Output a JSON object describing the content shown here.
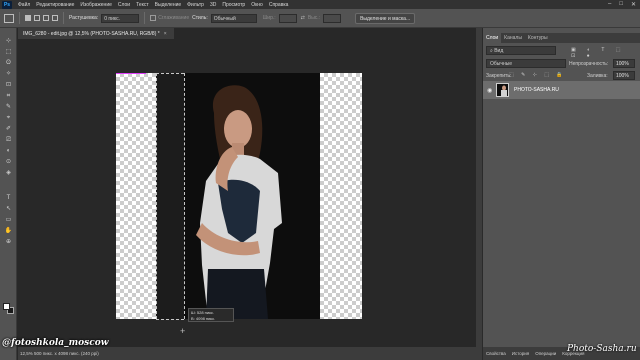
{
  "app": {
    "logo": "Ps",
    "menu": [
      "Файл",
      "Редактирование",
      "Изображение",
      "Слои",
      "Текст",
      "Выделение",
      "Фильтр",
      "3D",
      "Просмотр",
      "Окно",
      "Справка"
    ],
    "window_controls": [
      "–",
      "□",
      "✕"
    ]
  },
  "options": {
    "feather_label": "Растушевка:",
    "feather_value": "0 пикс.",
    "antialias_label": "Сглаживание",
    "style_label": "Стиль:",
    "style_value": "Обычный",
    "width_label": "Шир.:",
    "height_label": "Выс.:",
    "select_mask_button": "Выделение и маска..."
  },
  "tools": [
    "⊹",
    "⬚",
    "ʘ",
    "✧",
    "⊡",
    "⌗",
    "✎",
    "⌖",
    "✐",
    "⎚",
    "◐",
    "⊙",
    "◈",
    "T",
    "↖",
    "▭",
    "✋",
    "⊕"
  ],
  "document": {
    "tab_title": "IMG_6280 - edit.jpg @ 12,5% (PHOTO-SASHA.RU, RGB/8) *",
    "close_icon": "×",
    "readout_line1": "Ш: 528 пикс.",
    "readout_line2": "В: 4098 пикс."
  },
  "status": {
    "text": "12,5%    500 пикс. x 4098 пикс. (240 ppi)"
  },
  "watermark_left": "@fotoshkola_moscow",
  "watermark_right": "Photo-Sasha.ru",
  "layers_panel": {
    "tabs": [
      "Слои",
      "Каналы",
      "Контуры"
    ],
    "search_placeholder": "Вид",
    "filter_icons": "▣ ◐ T ⬚ ⊡ ●",
    "blend_mode": "Обычные",
    "opacity_label": "Непрозрачность:",
    "opacity_value": "100%",
    "lock_label": "Закрепить:",
    "lock_icons": "⬚ ✎ ⊹ ⬚ 🔒",
    "fill_label": "Заливка:",
    "fill_value": "100%",
    "layer_name": "PHOTO-SASHA.RU",
    "bottom_tabs": [
      "Свойства",
      "История",
      "Операции",
      "Коррекция"
    ]
  },
  "colors": {
    "accent": "#31a8ff",
    "panel_bg": "#535353",
    "canvas_bg": "#282828"
  }
}
